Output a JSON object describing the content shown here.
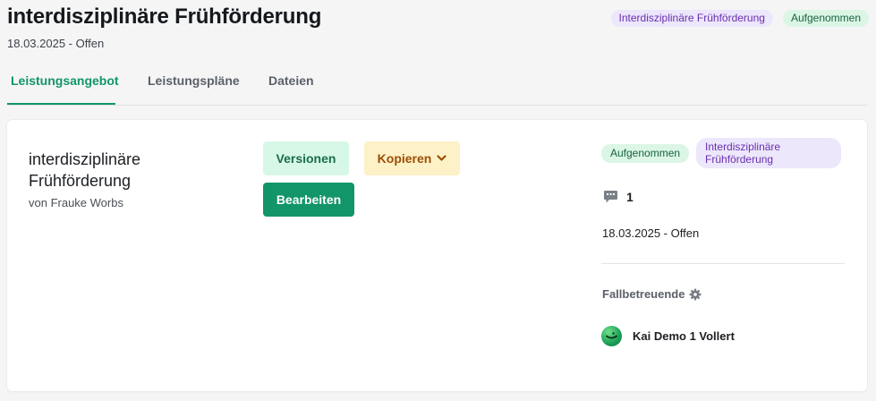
{
  "header": {
    "title": "interdisziplinäre Frühförderung",
    "subtitle": "18.03.2025 - Offen",
    "badges": {
      "program": "Interdisziplinäre Frühförderung",
      "status": "Aufgenommen"
    }
  },
  "tabs": [
    {
      "label": "Leistungsangebot",
      "active": true
    },
    {
      "label": "Leistungspläne",
      "active": false
    },
    {
      "label": "Dateien",
      "active": false
    }
  ],
  "card": {
    "title": "interdisziplinäre Frühförderung",
    "author": "von Frauke Worbs",
    "buttons": {
      "versions": "Versionen",
      "copy": "Kopieren",
      "edit": "Bearbeiten"
    },
    "sidebar": {
      "status_badge": "Aufgenommen",
      "program_badge": "Interdisziplinäre Frühförderung",
      "comment_count": "1",
      "date_status": "18.03.2025 - Offen",
      "case_workers_label": "Fallbetreuende",
      "case_worker_name": "Kai Demo 1 Vollert"
    }
  },
  "colors": {
    "accent": "#129568",
    "badge_purple_bg": "#ece7fb",
    "badge_green_bg": "#dcf6e6",
    "copy_button_bg": "#fdf1c7"
  },
  "icons": {
    "copy_dropdown": "chevron-down-icon",
    "comments": "speech-bubble-icon",
    "case_settings": "gear-icon"
  }
}
